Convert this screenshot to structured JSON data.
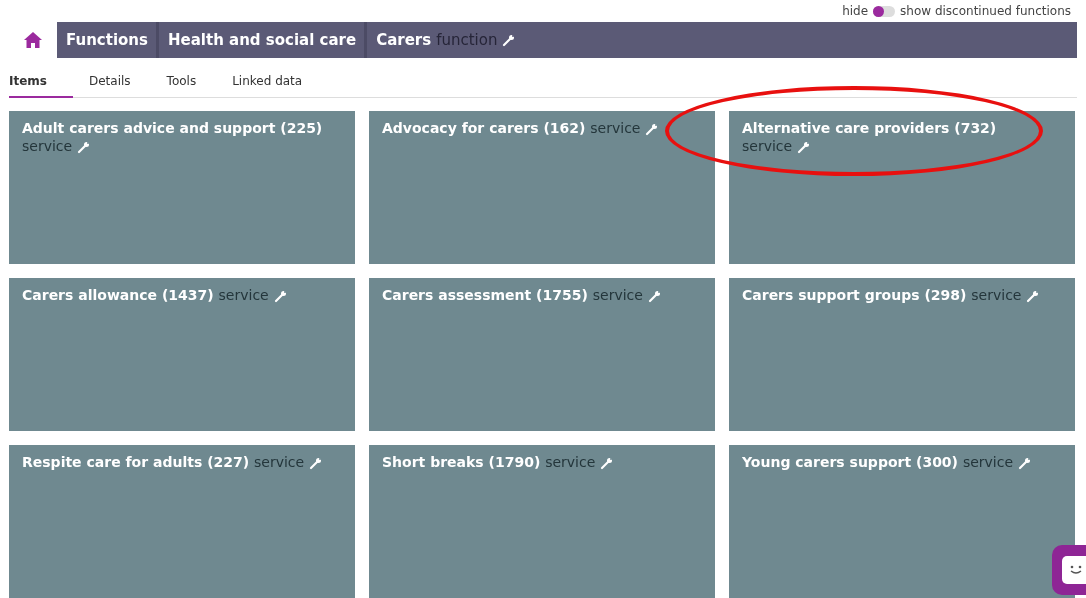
{
  "toggle": {
    "off_label": "hide",
    "on_label": "show discontinued functions",
    "on": false
  },
  "breadcrumbs": [
    {
      "label": "Functions"
    },
    {
      "label": "Health and social care"
    },
    {
      "label": "Carers",
      "type_label": "function"
    }
  ],
  "tabs": [
    {
      "label": "Items",
      "selected": true
    },
    {
      "label": "Details",
      "selected": false
    },
    {
      "label": "Tools",
      "selected": false
    },
    {
      "label": "Linked data",
      "selected": false
    }
  ],
  "tiles": [
    {
      "title": "Adult carers advice and support",
      "count": "(225)",
      "type_label": "service"
    },
    {
      "title": "Advocacy for carers",
      "count": "(162)",
      "type_label": "service"
    },
    {
      "title": "Alternative care providers",
      "count": "(732)",
      "type_label": "service",
      "highlighted": true
    },
    {
      "title": "Carers allowance",
      "count": "(1437)",
      "type_label": "service"
    },
    {
      "title": "Carers assessment",
      "count": "(1755)",
      "type_label": "service"
    },
    {
      "title": "Carers support groups",
      "count": "(298)",
      "type_label": "service"
    },
    {
      "title": "Respite care for adults",
      "count": "(227)",
      "type_label": "service"
    },
    {
      "title": "Short breaks",
      "count": "(1790)",
      "type_label": "service"
    },
    {
      "title": "Young carers support",
      "count": "(300)",
      "type_label": "service"
    }
  ]
}
